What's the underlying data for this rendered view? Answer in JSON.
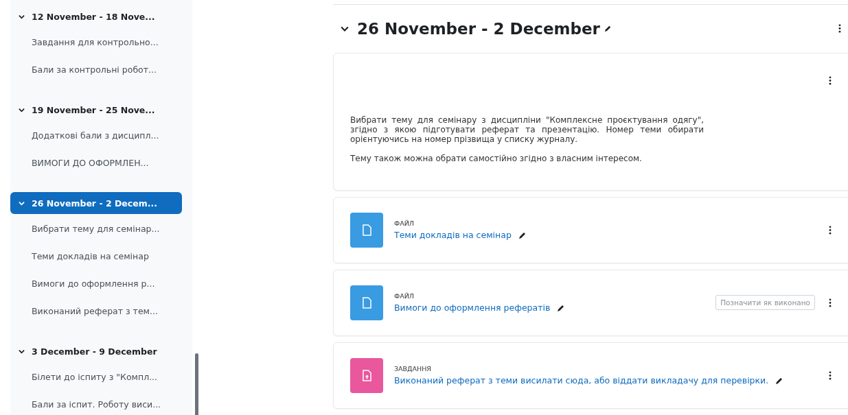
{
  "sidebar": {
    "sections": [
      {
        "title": "12 November - 18 Nove...",
        "expanded": true,
        "selected": false,
        "items": [
          "Завдання для контрольно...",
          "Бали за контрольні робот..."
        ]
      },
      {
        "title": "19 November - 25 Nove...",
        "expanded": true,
        "selected": false,
        "items": [
          "Додаткові бали з дисципл...",
          "ВИМОГИ ДО ОФОРМЛЕН..."
        ]
      },
      {
        "title": "26 November - 2 Decem...",
        "expanded": true,
        "selected": true,
        "items": [
          "Вибрати тему для семінар...",
          "Теми докладів на семінар",
          "Вимоги до оформлення р...",
          "Виконаний реферат з тем..."
        ]
      },
      {
        "title": "3 December - 9 December",
        "expanded": true,
        "selected": false,
        "items": [
          "Білети до іспиту з \"Компл...",
          "Бали за іспит. Роботу виси..."
        ]
      }
    ]
  },
  "section": {
    "title": "26 November - 2 December",
    "expanded": true,
    "description": [
      "Вибрати тему для семінару з дисципліни \"Комплексне проєктування одягу\", згідно з якою підготувати реферат та презентацію. Номер теми обирати орієнтуючись на номер прізвища у списку журналу.",
      "Тему також можна обрати самостійно згідно з власним інтересом."
    ],
    "activities": [
      {
        "kind": "file",
        "type_label": "ФАЙЛ",
        "name": "Теми докладів на семінар"
      },
      {
        "kind": "file",
        "type_label": "ФАЙЛ",
        "name": "Вимоги до оформлення рефератів",
        "completion": "Позначити як виконано"
      },
      {
        "kind": "assign",
        "type_label": "ЗАВДАННЯ",
        "name": "Виконаний реферат з теми висилати сюда, або віддати викладачу для перевірки."
      }
    ]
  }
}
